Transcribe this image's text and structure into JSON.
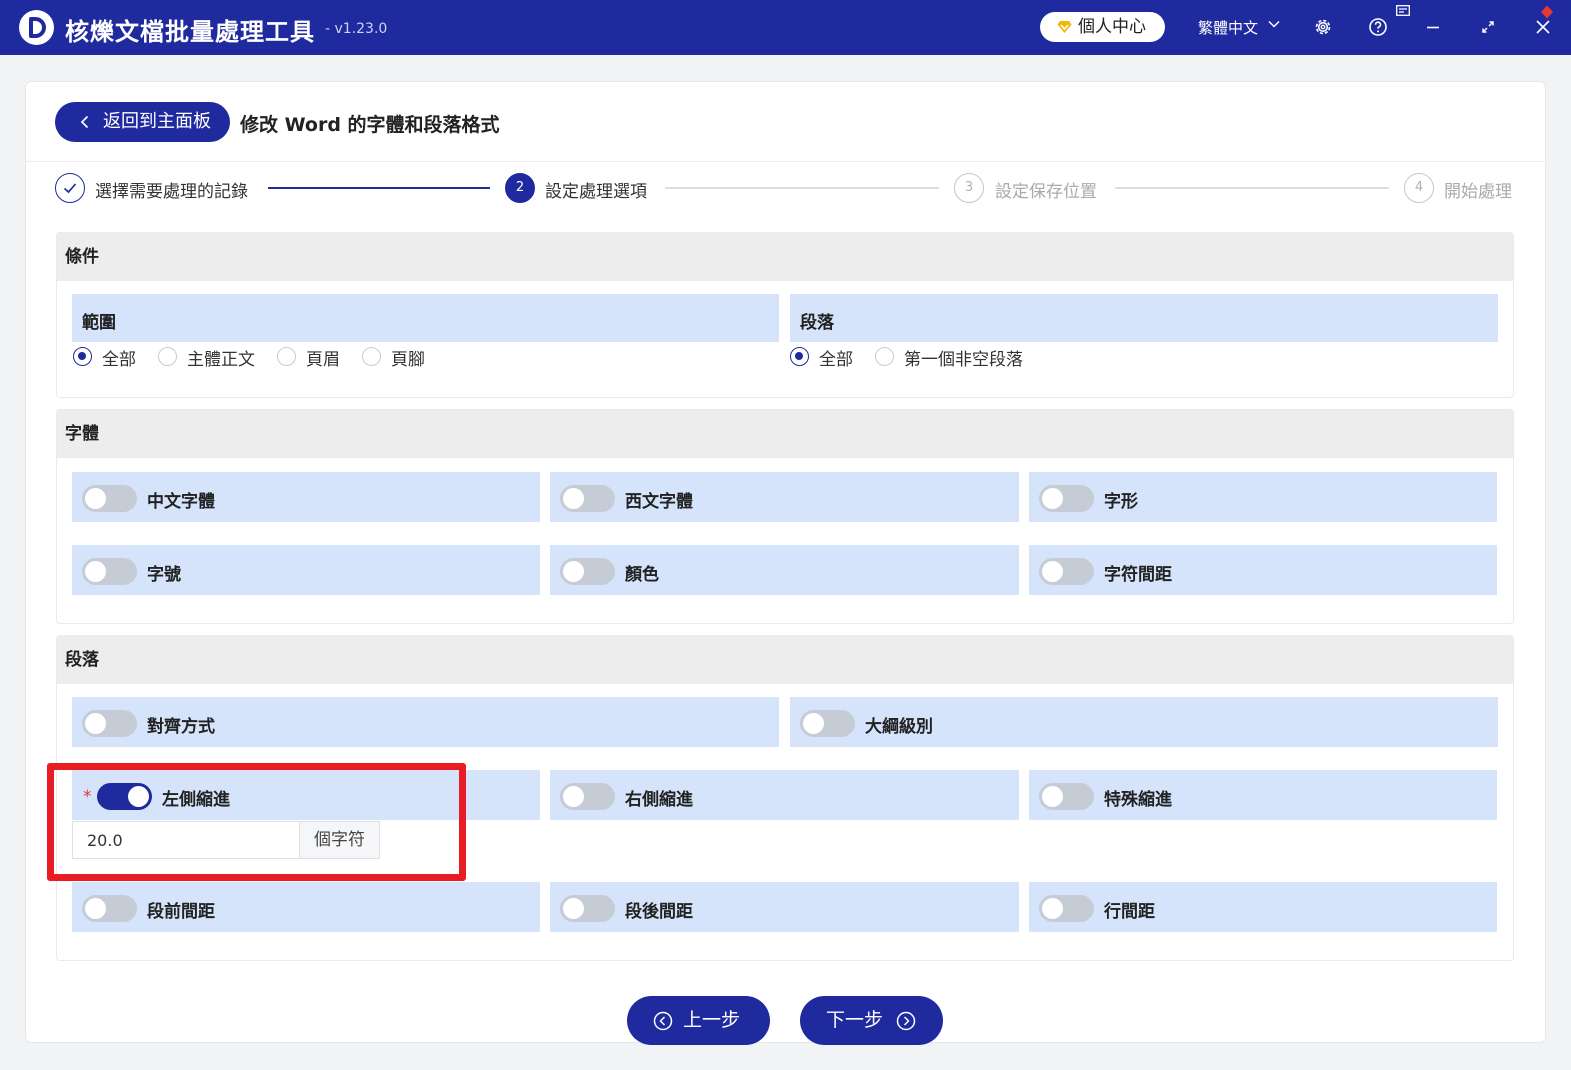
{
  "app": {
    "name": "核爍文檔批量處理工具",
    "version": "- v1.23.0"
  },
  "titlebar": {
    "user_center": "個人中心",
    "language": "繁體中文"
  },
  "header": {
    "back_label": "返回到主面板",
    "page_title": "修改 Word 的字體和段落格式"
  },
  "steps": [
    {
      "num": "",
      "label": "選擇需要處理的記錄",
      "state": "done"
    },
    {
      "num": "2",
      "label": "設定處理選項",
      "state": "active"
    },
    {
      "num": "3",
      "label": "設定保存位置",
      "state": "pending"
    },
    {
      "num": "4",
      "label": "開始處理",
      "state": "pending"
    }
  ],
  "conditions": {
    "title": "條件",
    "scope": {
      "title": "範圍",
      "options": [
        "全部",
        "主體正文",
        "頁眉",
        "頁腳"
      ],
      "selected": "全部"
    },
    "paragraph": {
      "title": "段落",
      "options": [
        "全部",
        "第一個非空段落"
      ],
      "selected": "全部"
    }
  },
  "font": {
    "title": "字體",
    "toggles": [
      {
        "label": "中文字體",
        "on": false
      },
      {
        "label": "西文字體",
        "on": false
      },
      {
        "label": "字形",
        "on": false
      },
      {
        "label": "字號",
        "on": false
      },
      {
        "label": "顏色",
        "on": false
      },
      {
        "label": "字符間距",
        "on": false
      }
    ]
  },
  "para": {
    "title": "段落",
    "toggles": [
      {
        "label": "對齊方式",
        "on": false
      },
      {
        "label": "大綱級別",
        "on": false
      },
      {
        "label": "左側縮進",
        "on": true
      },
      {
        "label": "右側縮進",
        "on": false
      },
      {
        "label": "特殊縮進",
        "on": false
      },
      {
        "label": "段前間距",
        "on": false
      },
      {
        "label": "段後間距",
        "on": false
      },
      {
        "label": "行間距",
        "on": false
      }
    ],
    "left_indent": {
      "required_mark": "*",
      "value": "20.0",
      "unit": "個字符"
    }
  },
  "footer": {
    "prev_label": "上一步",
    "next_label": "下一步"
  },
  "colors": {
    "primary": "#1f2a9e",
    "panel": "#d6e4fb",
    "highlight": "#e81c22"
  }
}
